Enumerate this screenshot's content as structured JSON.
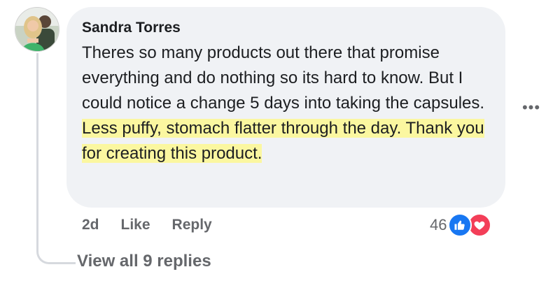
{
  "comment": {
    "author": "Sandra Torres",
    "text_plain": "Theres so many products out there that promise everything and do nothing so its hard to know. But I could notice a change 5 days into taking the capsules. ",
    "text_highlighted": "Less puffy, stomach flatter through the day. Thank you for creating this product.",
    "highlight_color": "#fbf7a0",
    "time": "2d",
    "like_label": "Like",
    "reply_label": "Reply",
    "reaction_count": "46",
    "reactions": [
      "like-icon",
      "love-icon"
    ],
    "more_icon": "more-options-icon"
  },
  "replies": {
    "view_label": "View all 9 replies"
  },
  "colors": {
    "bubble_bg": "#f0f2f5",
    "like_blue": "#1877f2",
    "love_red": "#f33e58",
    "meta_gray": "#65676b"
  }
}
